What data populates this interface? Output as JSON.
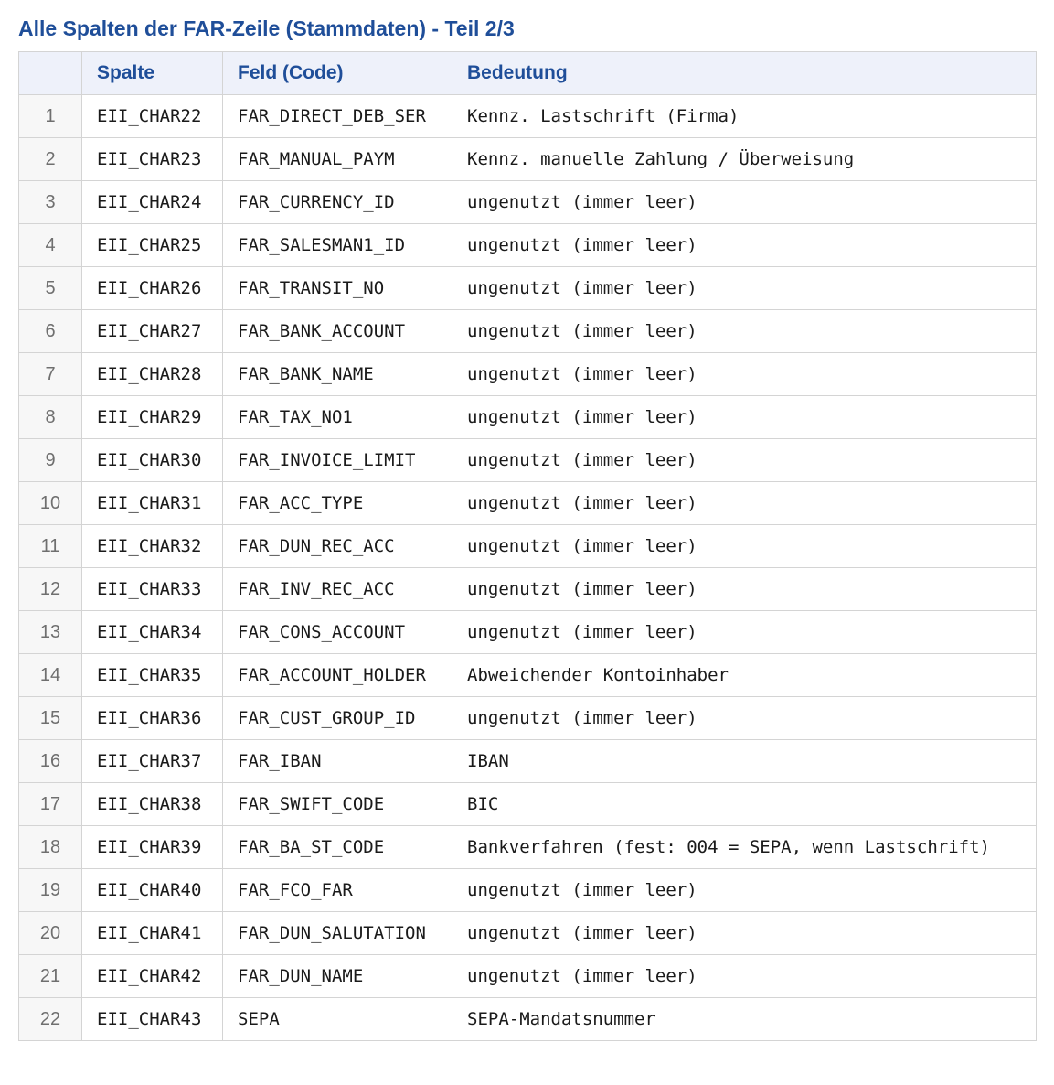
{
  "title": "Alle Spalten der FAR-Zeile (Stammdaten) - Teil 2/3",
  "colors": {
    "title": "#1f4e99",
    "header_bg": "#eef1fa",
    "index_bg": "#f7f7f7",
    "border": "#d4d4d4"
  },
  "table": {
    "headers": [
      "",
      "Spalte",
      "Feld (Code)",
      "Bedeutung"
    ],
    "rows": [
      {
        "idx": "1",
        "spalte": "EII_CHAR22",
        "feld": "FAR_DIRECT_DEB_SER",
        "bedeutung": "Kennz. Lastschrift (Firma)"
      },
      {
        "idx": "2",
        "spalte": "EII_CHAR23",
        "feld": "FAR_MANUAL_PAYM",
        "bedeutung": "Kennz. manuelle Zahlung / Überweisung"
      },
      {
        "idx": "3",
        "spalte": "EII_CHAR24",
        "feld": "FAR_CURRENCY_ID",
        "bedeutung": "ungenutzt (immer leer)"
      },
      {
        "idx": "4",
        "spalte": "EII_CHAR25",
        "feld": "FAR_SALESMAN1_ID",
        "bedeutung": "ungenutzt (immer leer)"
      },
      {
        "idx": "5",
        "spalte": "EII_CHAR26",
        "feld": "FAR_TRANSIT_NO",
        "bedeutung": "ungenutzt (immer leer)"
      },
      {
        "idx": "6",
        "spalte": "EII_CHAR27",
        "feld": "FAR_BANK_ACCOUNT",
        "bedeutung": "ungenutzt (immer leer)"
      },
      {
        "idx": "7",
        "spalte": "EII_CHAR28",
        "feld": "FAR_BANK_NAME",
        "bedeutung": "ungenutzt (immer leer)"
      },
      {
        "idx": "8",
        "spalte": "EII_CHAR29",
        "feld": "FAR_TAX_NO1",
        "bedeutung": "ungenutzt (immer leer)"
      },
      {
        "idx": "9",
        "spalte": "EII_CHAR30",
        "feld": "FAR_INVOICE_LIMIT",
        "bedeutung": "ungenutzt (immer leer)"
      },
      {
        "idx": "10",
        "spalte": "EII_CHAR31",
        "feld": "FAR_ACC_TYPE",
        "bedeutung": "ungenutzt (immer leer)"
      },
      {
        "idx": "11",
        "spalte": "EII_CHAR32",
        "feld": "FAR_DUN_REC_ACC",
        "bedeutung": "ungenutzt (immer leer)"
      },
      {
        "idx": "12",
        "spalte": "EII_CHAR33",
        "feld": "FAR_INV_REC_ACC",
        "bedeutung": "ungenutzt (immer leer)"
      },
      {
        "idx": "13",
        "spalte": "EII_CHAR34",
        "feld": "FAR_CONS_ACCOUNT",
        "bedeutung": "ungenutzt (immer leer)"
      },
      {
        "idx": "14",
        "spalte": "EII_CHAR35",
        "feld": "FAR_ACCOUNT_HOLDER",
        "bedeutung": "Abweichender Kontoinhaber"
      },
      {
        "idx": "15",
        "spalte": "EII_CHAR36",
        "feld": "FAR_CUST_GROUP_ID",
        "bedeutung": "ungenutzt (immer leer)"
      },
      {
        "idx": "16",
        "spalte": "EII_CHAR37",
        "feld": "FAR_IBAN",
        "bedeutung": "IBAN"
      },
      {
        "idx": "17",
        "spalte": "EII_CHAR38",
        "feld": "FAR_SWIFT_CODE",
        "bedeutung": "BIC"
      },
      {
        "idx": "18",
        "spalte": "EII_CHAR39",
        "feld": "FAR_BA_ST_CODE",
        "bedeutung": "Bankverfahren (fest: 004 = SEPA, wenn Lastschrift)"
      },
      {
        "idx": "19",
        "spalte": "EII_CHAR40",
        "feld": "FAR_FCO_FAR",
        "bedeutung": "ungenutzt (immer leer)"
      },
      {
        "idx": "20",
        "spalte": "EII_CHAR41",
        "feld": "FAR_DUN_SALUTATION",
        "bedeutung": "ungenutzt (immer leer)"
      },
      {
        "idx": "21",
        "spalte": "EII_CHAR42",
        "feld": "FAR_DUN_NAME",
        "bedeutung": "ungenutzt (immer leer)"
      },
      {
        "idx": "22",
        "spalte": "EII_CHAR43",
        "feld": "SEPA",
        "bedeutung": "SEPA-Mandatsnummer"
      }
    ]
  }
}
